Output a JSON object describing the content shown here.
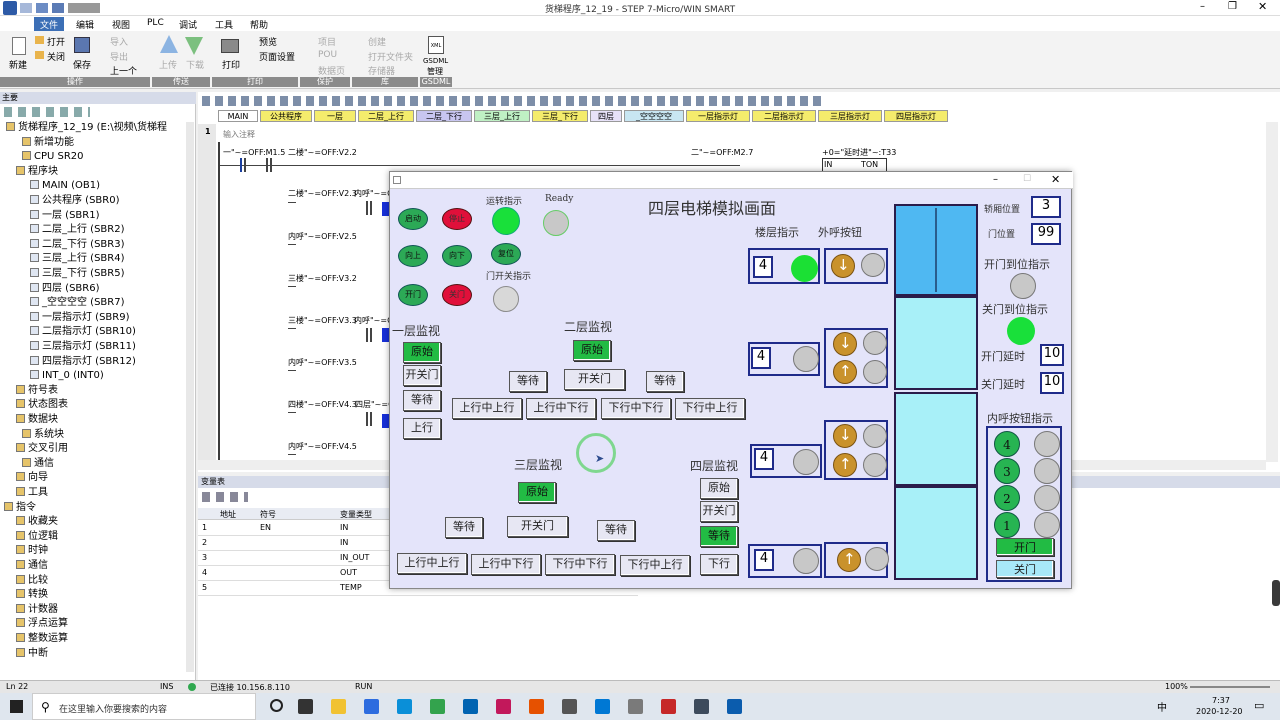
{
  "window": {
    "title": "货梯程序_12_19 - STEP 7-Micro/WIN SMART"
  },
  "menu": [
    "文件",
    "编辑",
    "视图",
    "PLC",
    "调试",
    "工具",
    "帮助"
  ],
  "ribbon": {
    "new": "新建",
    "open": "打开",
    "close": "关闭",
    "save": "保存",
    "import": "导入",
    "export": "导出",
    "prev": "上一个",
    "group_ops": "操作",
    "upload": "上传",
    "download": "下载",
    "group_transfer": "传送",
    "print": "打印",
    "preview": "预览",
    "page_setup": "页面设置",
    "group_print": "打印",
    "project": "项目",
    "pou": "POU",
    "datapage": "数据页",
    "group_protect": "保护",
    "create": "创建",
    "open_folder": "打开文件夹",
    "storage": "存储器",
    "group_lib": "库",
    "gsdml": "GSDML",
    "gsdml2": "管理",
    "group_gsdml": "GSDML"
  },
  "tree": {
    "header": "主要",
    "items": [
      "货梯程序_12_19 (E:\\视频\\货梯程",
      "新增功能",
      "CPU SR20",
      "程序块",
      "MAIN (OB1)",
      "公共程序 (SBR0)",
      "一层 (SBR1)",
      "二层_上行 (SBR2)",
      "二层_下行 (SBR3)",
      "三层_上行 (SBR4)",
      "三层_下行 (SBR5)",
      "四层 (SBR6)",
      "_空空空空 (SBR7)",
      "一层指示灯 (SBR9)",
      "二层指示灯 (SBR10)",
      "三层指示灯 (SBR11)",
      "四层指示灯 (SBR12)",
      "INT_0 (INT0)",
      "符号表",
      "状态图表",
      "数据块",
      "系统块",
      "交叉引用",
      "通信",
      "向导",
      "工具",
      "指令",
      "收藏夹",
      "位逻辑",
      "时钟",
      "通信",
      "比较",
      "转换",
      "计数器",
      "浮点运算",
      "整数运算",
      "中断"
    ]
  },
  "editor": {
    "tabs": [
      "MAIN",
      "公共程序",
      "一层",
      "二层_上行",
      "二层_下行",
      "三层_上行",
      "三层_下行",
      "四层",
      "_空空空空",
      "一层指示灯",
      "二层指示灯",
      "三层指示灯",
      "四层指示灯"
    ],
    "network_no": "1",
    "comment": "输入注释",
    "contacts": [
      "一\"~=OFF:M1.5",
      "二楼\"~=OFF:V2.2",
      "二楼\"~=OFF:V2.3",
      "内呼\"~=O",
      "内呼\"~=OFF:V2.5",
      "三楼\"~=OFF:V3.2",
      "三楼\"~=OFF:V3.3",
      "内呼\"~=O",
      "内呼\"~=OFF:V3.5",
      "四楼\"~=OFF:V4.3",
      "四层\"~=O",
      "内呼\"~=OFF:V4.5",
      "二\"~=OFF:M2.7",
      "+0=\"延时进\"~:T33",
      "IN",
      "TON"
    ]
  },
  "vartable": {
    "title": "变量表",
    "headers": [
      "地址",
      "符号",
      "变量类型"
    ],
    "rows": [
      [
        "1",
        "",
        "EN",
        "IN"
      ],
      [
        "2",
        "",
        "",
        "IN"
      ],
      [
        "3",
        "",
        "",
        "IN_OUT"
      ],
      [
        "4",
        "",
        "",
        "OUT"
      ],
      [
        "5",
        "",
        "",
        "TEMP"
      ]
    ]
  },
  "status": {
    "line": "Ln 22",
    "ins": "INS",
    "conn": "已连接 10.156.8.110",
    "run": "RUN",
    "zoom": "100%"
  },
  "taskbar": {
    "search": "在这里输入你要搜索的内容",
    "time": "7:37",
    "date": "2020-12-20",
    "ime": "中"
  },
  "hmi": {
    "title": "四层电梯模拟画面",
    "run_label": "运转指示",
    "ready_label": "Ready",
    "door_sw_label": "门开关指示",
    "btn_start": "启动",
    "btn_stop": "停止",
    "btn_up": "向上",
    "btn_down": "向下",
    "btn_reset": "复位",
    "btn_open": "开门",
    "btn_close": "关门",
    "floor_ind": "楼层指示",
    "outer_btn": "外呼按钮",
    "floors": [
      "4",
      "4",
      "4",
      "4"
    ],
    "car_pos_label": "轿厢位置",
    "car_pos": "3",
    "door_pos_label": "门位置",
    "door_pos": "99",
    "open_done": "开门到位指示",
    "close_done": "关门到位指示",
    "open_delay_label": "开门延时",
    "open_delay": "10",
    "close_delay_label": "关门延时",
    "close_delay": "10",
    "inner_label": "内呼按钮指示",
    "inner_btns": [
      "4",
      "3",
      "2",
      "1"
    ],
    "inner_open": "开门",
    "inner_close": "关门",
    "f1": {
      "title": "一层监视",
      "items": [
        "原始",
        "开关门",
        "等待",
        "上行"
      ]
    },
    "f2": {
      "title": "二层监视",
      "items": [
        "原始",
        "等待",
        "开关门",
        "等待",
        "上行中上行",
        "上行中下行",
        "下行中下行",
        "下行中上行"
      ]
    },
    "f3": {
      "title": "三层监视",
      "items": [
        "原始",
        "等待",
        "开关门",
        "等待",
        "上行中上行",
        "上行中下行",
        "下行中下行",
        "下行中上行"
      ]
    },
    "f4": {
      "title": "四层监视",
      "items": [
        "原始",
        "开关门",
        "等待",
        "下行"
      ]
    },
    "colors": {
      "green": "#22bb44",
      "red": "#e0103a",
      "bg": "#e4e4fa"
    }
  }
}
